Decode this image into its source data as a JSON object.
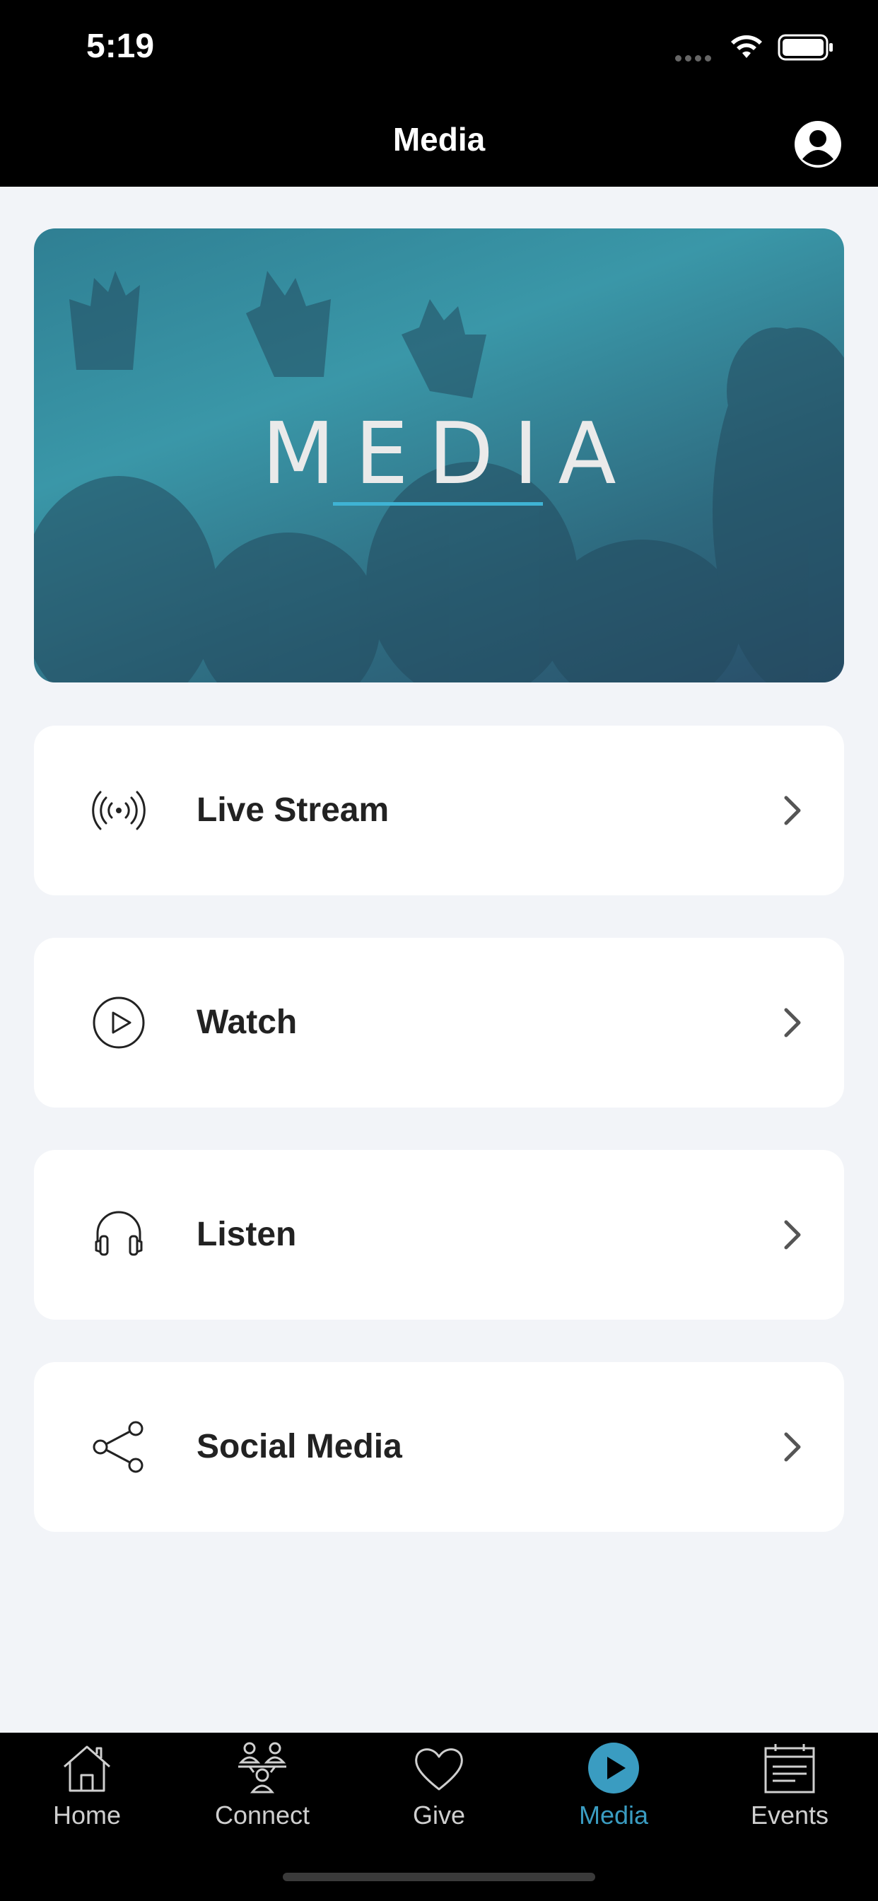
{
  "status_bar": {
    "time": "5:19"
  },
  "nav": {
    "title": "Media"
  },
  "hero": {
    "title": "MEDIA"
  },
  "menu": [
    {
      "label": "Live Stream",
      "icon": "broadcast-icon"
    },
    {
      "label": "Watch",
      "icon": "play-circle-icon"
    },
    {
      "label": "Listen",
      "icon": "headphones-icon"
    },
    {
      "label": "Social Media",
      "icon": "share-icon"
    }
  ],
  "tabs": [
    {
      "label": "Home",
      "icon": "home-icon"
    },
    {
      "label": "Connect",
      "icon": "people-icon"
    },
    {
      "label": "Give",
      "icon": "heart-icon"
    },
    {
      "label": "Media",
      "icon": "play-icon",
      "active": true
    },
    {
      "label": "Events",
      "icon": "calendar-icon"
    }
  ],
  "colors": {
    "accent": "#3a9cc1",
    "background": "#f2f4f8",
    "bar": "#000000"
  }
}
